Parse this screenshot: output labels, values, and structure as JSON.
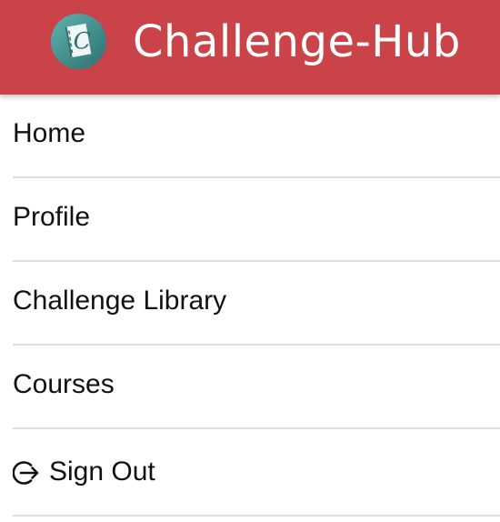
{
  "header": {
    "brand": "Challenge-Hub",
    "logo_icon": "book-c-logo-icon",
    "background_color": "#c94348",
    "logo_color": "#3e8d8b"
  },
  "menu": {
    "items": [
      {
        "label": "Home"
      },
      {
        "label": "Profile"
      },
      {
        "label": "Challenge Library"
      },
      {
        "label": "Courses"
      },
      {
        "label": "Sign Out",
        "icon": "sign-out-icon"
      }
    ]
  }
}
